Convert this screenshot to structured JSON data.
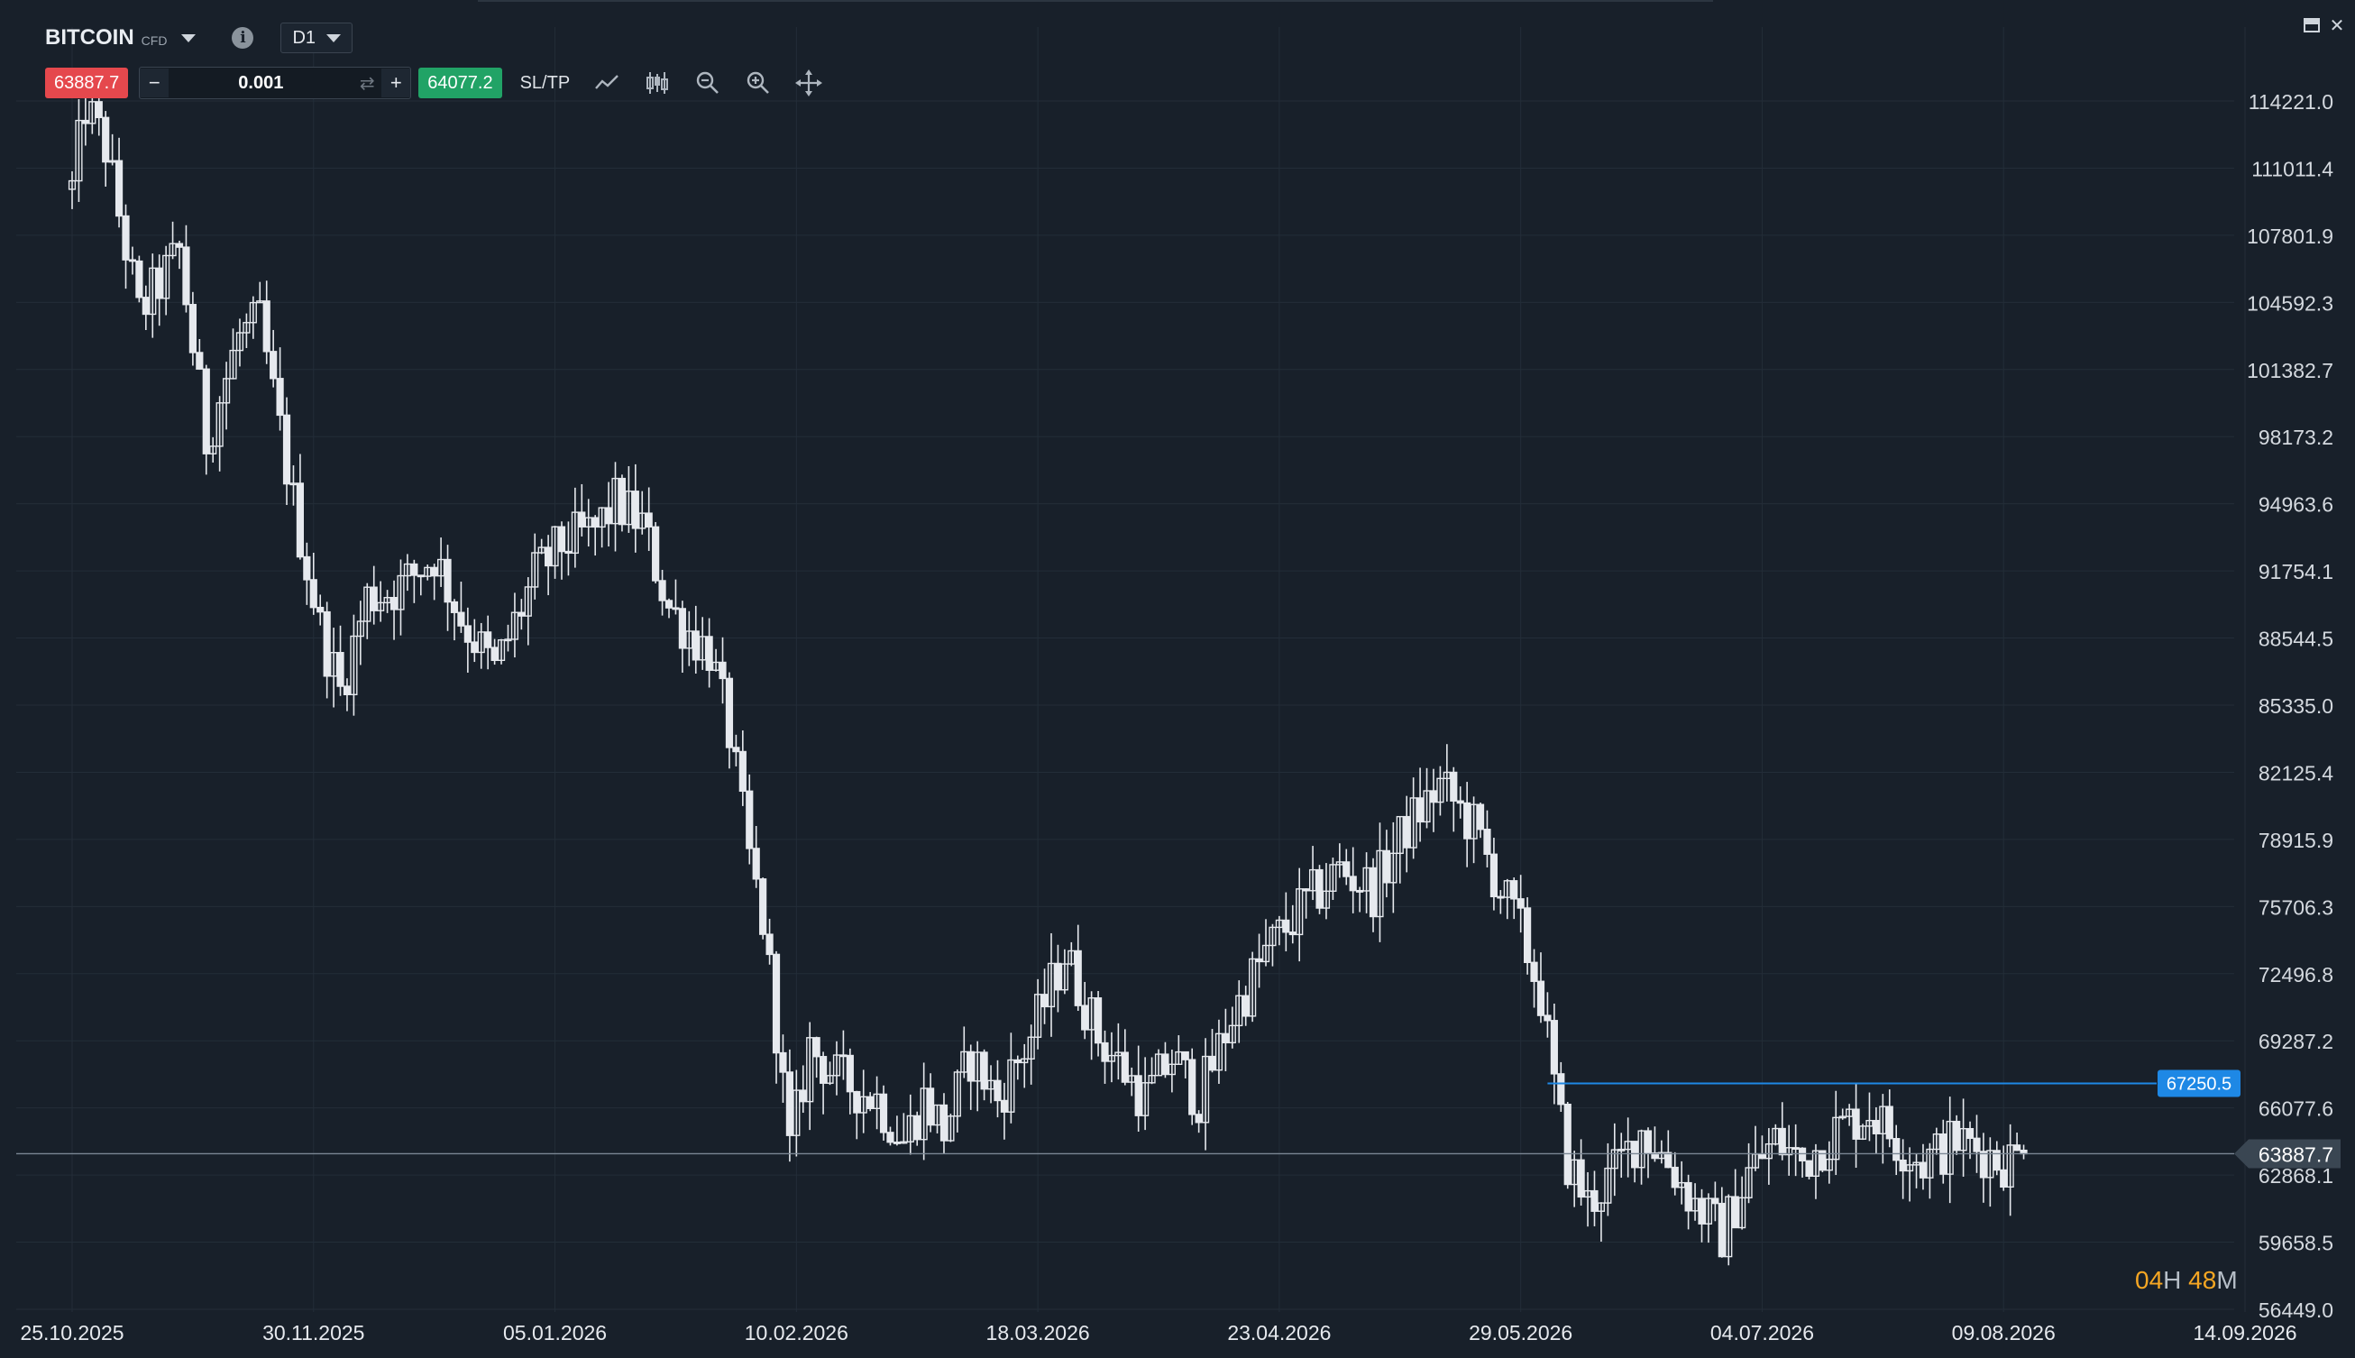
{
  "header": {
    "symbol": "BITCOIN",
    "instrument_type": "CFD",
    "timeframe": "D1"
  },
  "trade": {
    "sell_price": "63887.7",
    "buy_price": "64077.2",
    "quantity": "0.001",
    "minus_label": "−",
    "plus_label": "+",
    "sltp_label": "SL/TP"
  },
  "icons": [
    "chevron-down-icon",
    "info-icon",
    "swap-icon",
    "line-chart-icon",
    "candlestick-icon",
    "zoom-out-icon",
    "zoom-in-icon",
    "move-icon",
    "minimize-icon",
    "close-icon"
  ],
  "countdown": {
    "hours": "04",
    "hours_unit": "H",
    "minutes": "48",
    "minutes_unit": "M"
  },
  "colors": {
    "background": "#18202a",
    "grid": "#232d38",
    "sell": "#e5484d",
    "buy": "#21a366",
    "level_line": "#1e88e5",
    "countdown": "#f5a623",
    "candle": "#e6e9ee"
  },
  "chart_data": {
    "type": "candlestick",
    "timeframe": "D1",
    "y_ticks": [
      "114221.0",
      "111011.4",
      "107801.9",
      "104592.3",
      "101382.7",
      "98173.2",
      "94963.6",
      "91754.1",
      "88544.5",
      "85335.0",
      "82125.4",
      "78915.9",
      "75706.3",
      "72496.8",
      "69287.2",
      "66077.6",
      "62868.1",
      "59658.5",
      "56449.0"
    ],
    "ylim": [
      56449.0,
      114221.0
    ],
    "x_ticks": [
      "25.10.2025",
      "30.11.2025",
      "05.01.2026",
      "10.02.2026",
      "18.03.2026",
      "23.04.2026",
      "29.05.2026",
      "04.07.2026",
      "09.08.2026",
      "14.09.2026"
    ],
    "current_price": 63887.7,
    "current_price_label": "63887.7",
    "horizontal_level": {
      "value": 67250.5,
      "label": "67250.5",
      "start_date": "2026-06-02"
    },
    "close_path": [
      [
        "2025-10-25",
        110000
      ],
      [
        "2025-10-27",
        114000
      ],
      [
        "2025-10-30",
        112000
      ],
      [
        "2025-11-04",
        104000
      ],
      [
        "2025-11-10",
        107000
      ],
      [
        "2025-11-14",
        98000
      ],
      [
        "2025-11-19",
        103000
      ],
      [
        "2025-11-22",
        103600
      ],
      [
        "2025-11-27",
        95000
      ],
      [
        "2025-12-01",
        89000
      ],
      [
        "2025-12-04",
        86000
      ],
      [
        "2025-12-08",
        90500
      ],
      [
        "2025-12-13",
        91000
      ],
      [
        "2025-12-18",
        92500
      ],
      [
        "2025-12-22",
        89500
      ],
      [
        "2025-12-27",
        87000
      ],
      [
        "2026-01-02",
        91500
      ],
      [
        "2026-01-06",
        93000
      ],
      [
        "2026-01-11",
        93700
      ],
      [
        "2026-01-14",
        95000
      ],
      [
        "2026-01-18",
        94000
      ],
      [
        "2026-01-22",
        90000
      ],
      [
        "2026-01-26",
        88500
      ],
      [
        "2026-01-28",
        88000
      ],
      [
        "2026-01-31",
        84000
      ],
      [
        "2026-02-03",
        78000
      ],
      [
        "2026-02-05",
        75000
      ],
      [
        "2026-02-07",
        70000
      ],
      [
        "2026-02-09",
        64000
      ],
      [
        "2026-02-12",
        69000
      ],
      [
        "2026-02-16",
        67500
      ],
      [
        "2026-02-22",
        66500
      ],
      [
        "2026-02-26",
        64500
      ],
      [
        "2026-03-01",
        66500
      ],
      [
        "2026-03-04",
        65000
      ],
      [
        "2026-03-08",
        68500
      ],
      [
        "2026-03-12",
        66500
      ],
      [
        "2026-03-17",
        69500
      ],
      [
        "2026-03-22",
        73500
      ],
      [
        "2026-03-27",
        69500
      ],
      [
        "2026-04-03",
        66500
      ],
      [
        "2026-04-07",
        68500
      ],
      [
        "2026-04-11",
        66500
      ],
      [
        "2026-04-16",
        70500
      ],
      [
        "2026-04-21",
        73500
      ],
      [
        "2026-04-26",
        75500
      ],
      [
        "2026-05-02",
        77500
      ],
      [
        "2026-05-07",
        76500
      ],
      [
        "2026-05-12",
        79500
      ],
      [
        "2026-05-17",
        81500
      ],
      [
        "2026-05-22",
        79500
      ],
      [
        "2026-05-26",
        76500
      ],
      [
        "2026-05-29",
        74500
      ],
      [
        "2026-06-01",
        71500
      ],
      [
        "2026-06-03",
        67000
      ],
      [
        "2026-06-05",
        63500
      ],
      [
        "2026-06-08",
        61500
      ],
      [
        "2026-06-12",
        63000
      ],
      [
        "2026-06-16",
        65000
      ],
      [
        "2026-06-20",
        63500
      ],
      [
        "2026-06-24",
        61500
      ],
      [
        "2026-06-28",
        60000
      ],
      [
        "2026-07-02",
        63000
      ],
      [
        "2026-07-06",
        64500
      ],
      [
        "2026-07-10",
        63500
      ],
      [
        "2026-07-15",
        65000
      ],
      [
        "2026-07-20",
        66000
      ],
      [
        "2026-07-24",
        64500
      ],
      [
        "2026-07-28",
        63500
      ],
      [
        "2026-08-02",
        64500
      ],
      [
        "2026-08-06",
        64000
      ],
      [
        "2026-08-09",
        63500
      ],
      [
        "2026-08-12",
        63887.7
      ]
    ]
  }
}
